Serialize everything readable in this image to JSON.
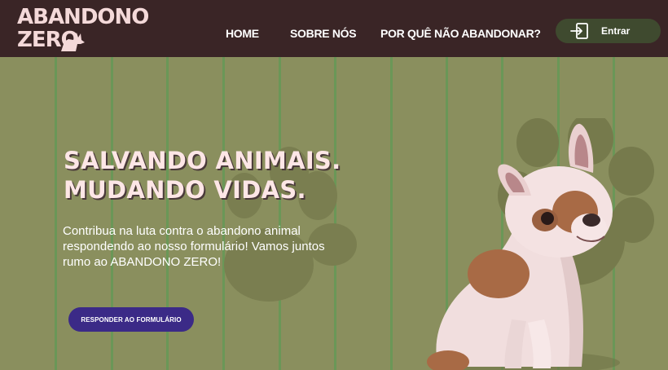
{
  "header": {
    "logo_line1": "ABANDONO",
    "logo_line2": "ZERO",
    "nav": [
      {
        "label": "HOME"
      },
      {
        "label": "SOBRE NÓS"
      },
      {
        "label": "POR QUÊ NÃO ABANDONAR?"
      }
    ],
    "login_label": "Entrar"
  },
  "hero": {
    "title_line1": "SALVANDO ANIMAIS.",
    "title_line2": "MUDANDO VIDAS.",
    "description": "Contribua na luta contra o abandono animal respondendo ao nosso formulário! Vamos juntos rumo ao ABANDONO ZERO!",
    "cta_label": "RESPONDER AO FORMULÁRIO"
  },
  "colors": {
    "header_bg": "#3a2526",
    "hero_bg": "#8a8f5e",
    "accent_purple": "#3b2a87",
    "login_bg": "#3f4a2f",
    "logo_pink": "#f4d9d9"
  },
  "icons": [
    "dog-logo-icon",
    "login-arrow-icon",
    "paw-print-icon"
  ]
}
